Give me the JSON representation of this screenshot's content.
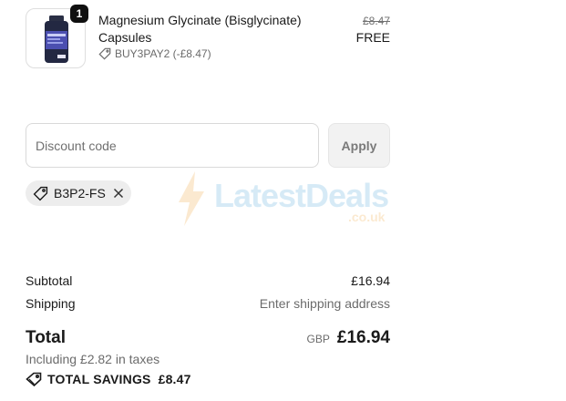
{
  "line_item": {
    "quantity": "1",
    "name": "Magnesium Glycinate (Bisglycinate) Capsules",
    "discount_tag": "BUY3PAY2 (-£8.47)",
    "original_price": "£8.47",
    "price": "FREE"
  },
  "discount": {
    "placeholder": "Discount code",
    "apply_label": "Apply",
    "applied_code": "B3P2-FS"
  },
  "watermark": {
    "text": "LatestDeals",
    "sub": ".co.uk"
  },
  "summary": {
    "subtotal_label": "Subtotal",
    "subtotal_value": "£16.94",
    "shipping_label": "Shipping",
    "shipping_value": "Enter shipping address",
    "total_label": "Total",
    "currency": "GBP",
    "total_value": "£16.94",
    "taxes_note": "Including £2.82 in taxes",
    "savings_label": "TOTAL SAVINGS",
    "savings_value": "£8.47"
  },
  "icons": {
    "tag": "tag-icon",
    "close": "close-icon",
    "savings_tag": "savings-tag-icon"
  }
}
